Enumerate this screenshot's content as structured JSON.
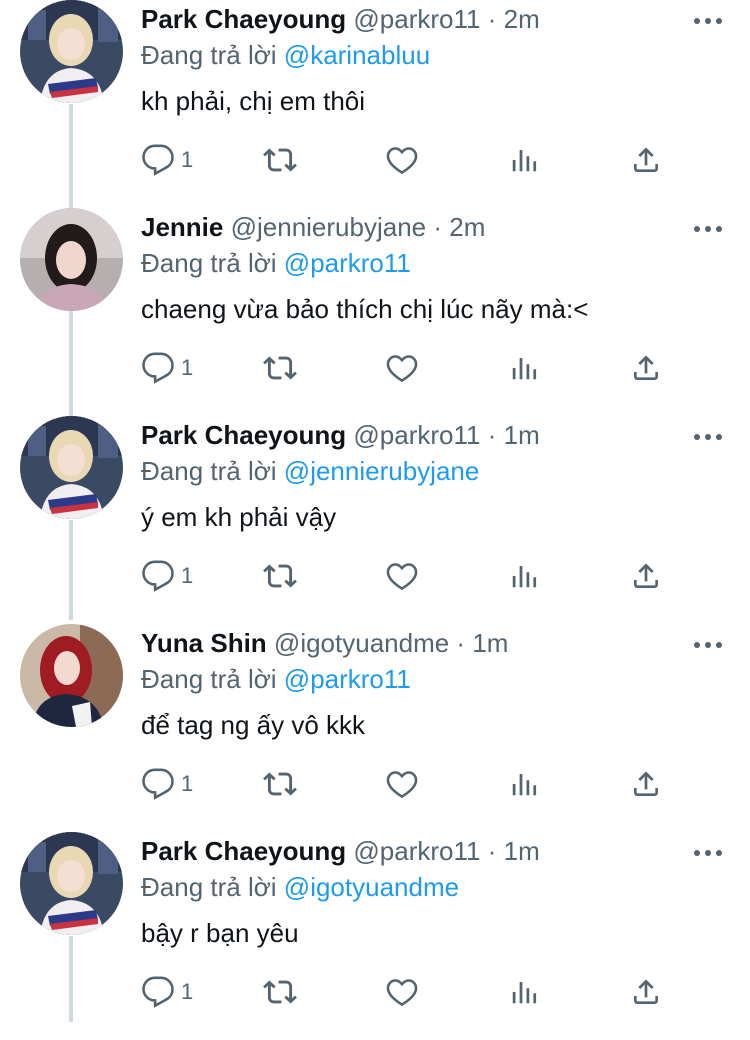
{
  "reply_prefix": "Đang trả lời",
  "tweets": [
    {
      "name": "Park Chaeyoung",
      "handle": "@parkro11",
      "dot": "·",
      "time": "2m",
      "reply_to": "@karinabluu",
      "text": "kh phải, chị em thôi",
      "reply_count": "1",
      "avatar": "rose"
    },
    {
      "name": "Jennie",
      "handle": "@jennierubyjane",
      "dot": "·",
      "time": "2m",
      "reply_to": "@parkro11",
      "text": "chaeng vừa bảo thích chị lúc nãy mà:<",
      "reply_count": "1",
      "avatar": "jennie"
    },
    {
      "name": "Park Chaeyoung",
      "handle": "@parkro11",
      "dot": "·",
      "time": "1m",
      "reply_to": "@jennierubyjane",
      "text": "ý em kh phải vậy",
      "reply_count": "1",
      "avatar": "rose"
    },
    {
      "name": "Yuna Shin",
      "handle": "@igotyuandme",
      "dot": "·",
      "time": "1m",
      "reply_to": "@parkro11",
      "text": "để tag ng ấy vô kkk",
      "reply_count": "1",
      "avatar": "yuna"
    },
    {
      "name": "Park Chaeyoung",
      "handle": "@parkro11",
      "dot": "·",
      "time": "1m",
      "reply_to": "@igotyuandme",
      "text": "bậy r bạn yêu",
      "reply_count": "1",
      "avatar": "rose"
    }
  ],
  "icons": {
    "reply": "reply-icon",
    "retweet": "retweet-icon",
    "like": "heart-icon",
    "views": "analytics-icon",
    "share": "share-icon",
    "more": "more-icon"
  },
  "colors": {
    "text": "#0f1419",
    "secondary": "#536471",
    "accent": "#1d9bf0",
    "thread": "#cfd9de"
  }
}
